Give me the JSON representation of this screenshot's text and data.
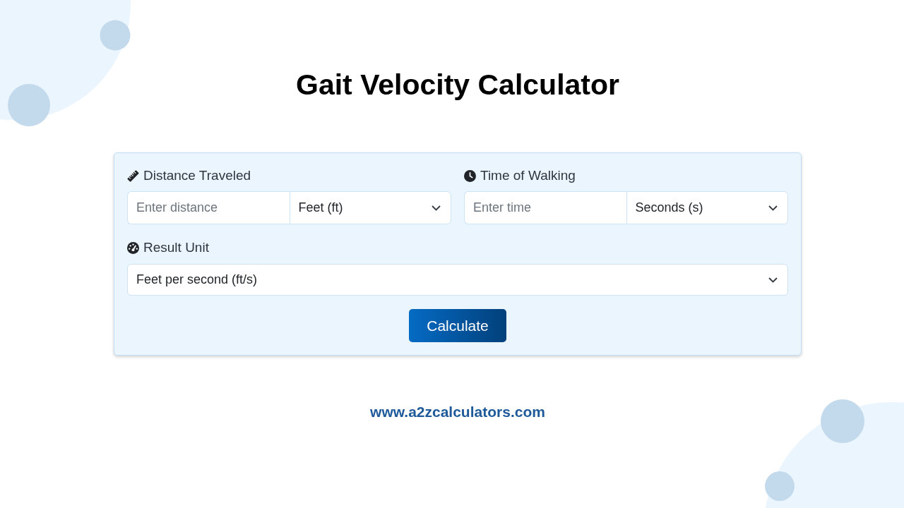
{
  "title": "Gait Velocity Calculator",
  "distance": {
    "label": "Distance Traveled",
    "placeholder": "Enter distance",
    "unit": "Feet (ft)"
  },
  "time": {
    "label": "Time of Walking",
    "placeholder": "Enter time",
    "unit": "Seconds (s)"
  },
  "result_unit": {
    "label": "Result Unit",
    "value": "Feet per second (ft/s)"
  },
  "calculate_button": "Calculate",
  "footer": "www.a2zcalculators.com"
}
